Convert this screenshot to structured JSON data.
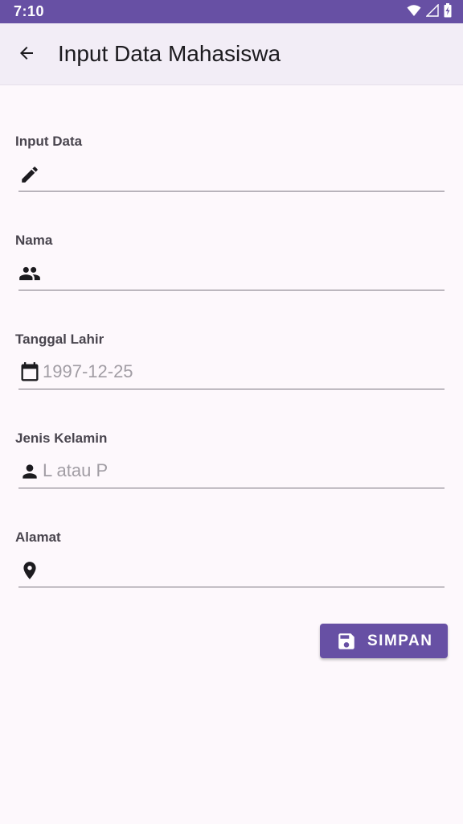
{
  "status_bar": {
    "time": "7:10",
    "icons": [
      "wifi-icon",
      "signal-icon",
      "battery-charging-icon"
    ]
  },
  "app_bar": {
    "back_icon": "arrow-back-icon",
    "title": "Input Data Mahasiswa"
  },
  "form": {
    "fields": [
      {
        "label": "Input Data",
        "icon": "pencil-icon",
        "value": "",
        "placeholder": ""
      },
      {
        "label": "Nama",
        "icon": "people-icon",
        "value": "",
        "placeholder": ""
      },
      {
        "label": "Tanggal Lahir",
        "icon": "calendar-icon",
        "value": "",
        "placeholder": "1997-12-25"
      },
      {
        "label": "Jenis Kelamin",
        "icon": "person-icon",
        "value": "",
        "placeholder": "L atau P"
      },
      {
        "label": "Alamat",
        "icon": "location-pin-icon",
        "value": "",
        "placeholder": ""
      }
    ],
    "save_button": {
      "label": "SIMPAN",
      "icon": "save-icon"
    }
  },
  "colors": {
    "primary": "#6750a4",
    "app_bar_bg": "#f2edf6",
    "page_bg": "#fdf8fc"
  }
}
